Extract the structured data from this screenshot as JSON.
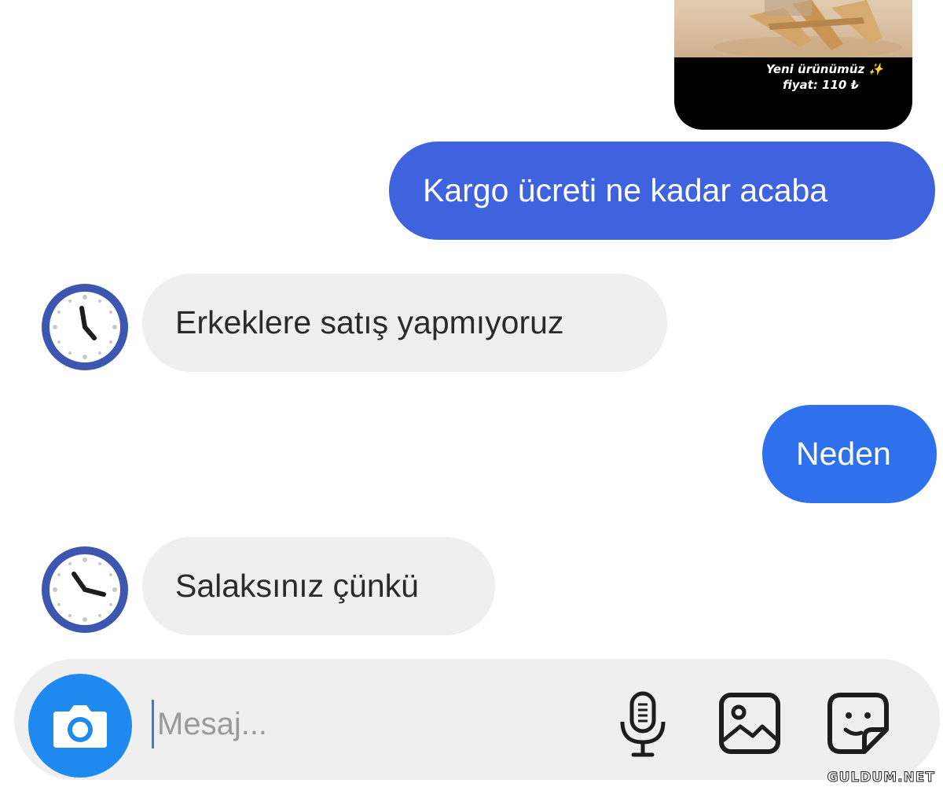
{
  "shared_post": {
    "caption_line1": "Yeni ürünümüz ✨",
    "caption_line2": "fiyat: 110 ₺"
  },
  "messages": [
    {
      "text": "Kargo ücreti ne kadar acaba",
      "direction": "outgoing",
      "color": "#3f63df"
    },
    {
      "text": "Erkeklere satış yapmıyoruz",
      "direction": "incoming",
      "avatar": "clock-icon"
    },
    {
      "text": "Neden",
      "direction": "outgoing",
      "color": "#2f71ec"
    },
    {
      "text": "Salaksınız çünkü",
      "direction": "incoming",
      "avatar": "clock-icon"
    }
  ],
  "composer": {
    "placeholder": "Mesaj...",
    "camera_icon": "camera-icon",
    "mic_icon": "microphone-icon",
    "gallery_icon": "image-gallery-icon",
    "sticker_icon": "sticker-icon",
    "accent_color": "#1e8af0"
  },
  "watermark": "GULDUM.NET"
}
